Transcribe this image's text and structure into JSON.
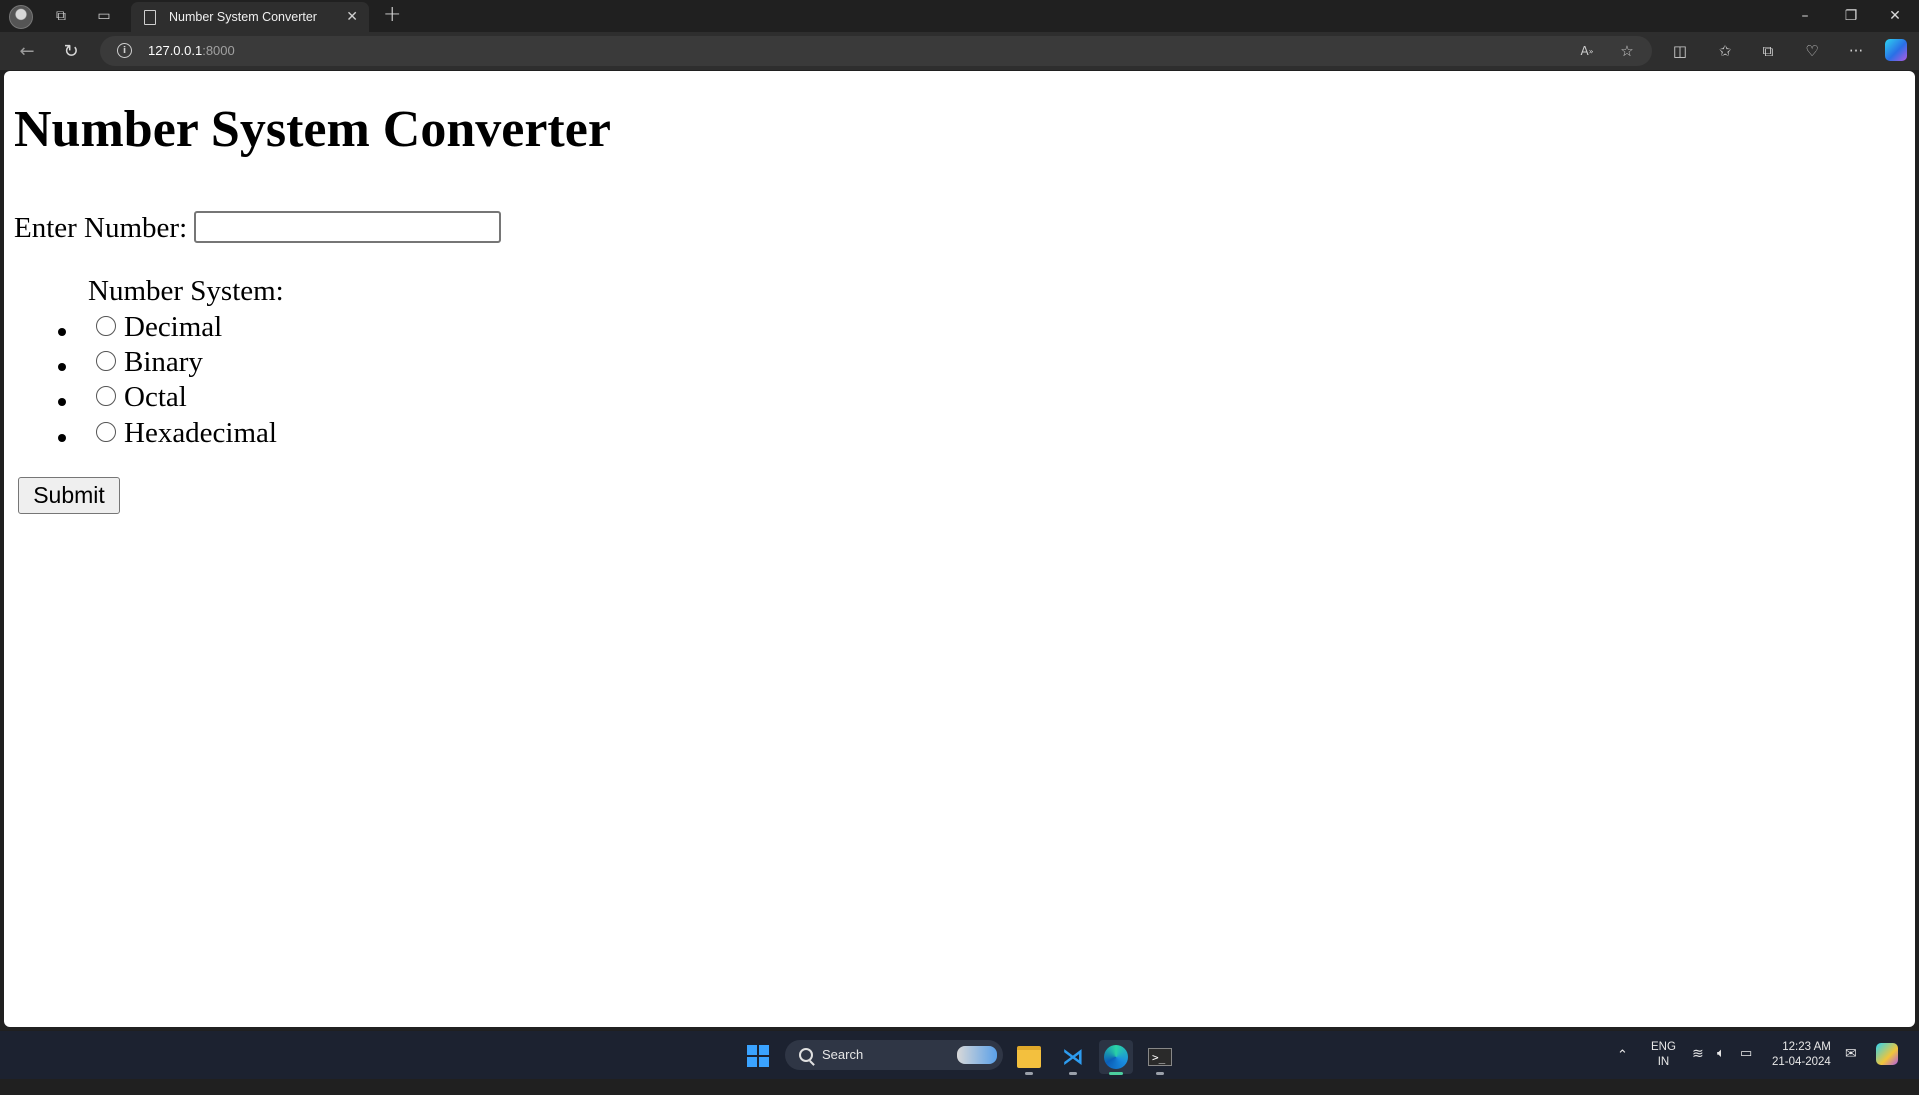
{
  "browser": {
    "tab_title": "Number System Converter",
    "url_host": "127.0.0.1",
    "url_port": ":8000",
    "new_tab_symbol": "+",
    "tab_close_symbol": "✕"
  },
  "page": {
    "heading": "Number System Converter",
    "enter_number_label": "Enter Number:",
    "number_input_value": "",
    "number_system_label": "Number System:",
    "options": [
      {
        "label": "Decimal",
        "checked": false
      },
      {
        "label": "Binary",
        "checked": false
      },
      {
        "label": "Octal",
        "checked": false
      },
      {
        "label": "Hexadecimal",
        "checked": false
      }
    ],
    "submit_label": "Submit"
  },
  "taskbar": {
    "search_label": "Search",
    "language": "ENG",
    "region": "IN",
    "time": "12:23 AM",
    "date": "21-04-2024"
  },
  "colors": {
    "titlebar": "#202020",
    "toolbar": "#2e2e2e",
    "taskbar": "#1c2230",
    "accent": "#3aa3ff"
  }
}
